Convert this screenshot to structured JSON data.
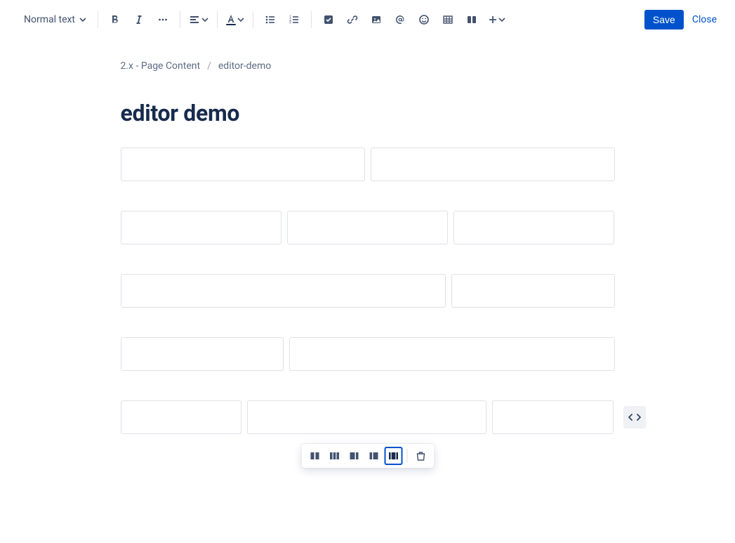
{
  "toolbar": {
    "text_style": "Normal text",
    "save_label": "Save",
    "close_label": "Close"
  },
  "breadcrumb": {
    "parent": "2.x - Page Content",
    "current": "editor-demo"
  },
  "page": {
    "title": "editor demo"
  },
  "layouts": [
    {
      "type": "two-equal",
      "widths": [
        "50%",
        "50%"
      ]
    },
    {
      "type": "three-equal",
      "widths": [
        "33.333%",
        "33.333%",
        "33.333%"
      ]
    },
    {
      "type": "two-left-wide",
      "widths": [
        "66%",
        "34%"
      ]
    },
    {
      "type": "two-right-wide",
      "widths": [
        "33.333%",
        "66.666%"
      ]
    },
    {
      "type": "three-center-wide",
      "widths": [
        "25%",
        "49%",
        "25%"
      ],
      "selected": true
    }
  ],
  "layout_popup_options": [
    "two-equal",
    "three-equal",
    "two-left-wide",
    "two-right-wide",
    "three-center-wide"
  ],
  "icons": {
    "bold": "bold-icon",
    "italic": "italic-icon",
    "more": "more-icon",
    "align": "align-icon",
    "text_color": "text-color-icon",
    "bullet_list": "bullet-list-icon",
    "numbered_list": "numbered-list-icon",
    "task": "task-icon",
    "link": "link-icon",
    "image": "image-icon",
    "mention": "mention-icon",
    "emoji": "emoji-icon",
    "table": "table-icon",
    "layout": "layout-icon",
    "plus": "plus-icon",
    "trash": "trash-icon",
    "go_wide": "go-wide-icon"
  },
  "colors": {
    "accent": "#0052CC",
    "text_color_underline": "#172B4D"
  }
}
